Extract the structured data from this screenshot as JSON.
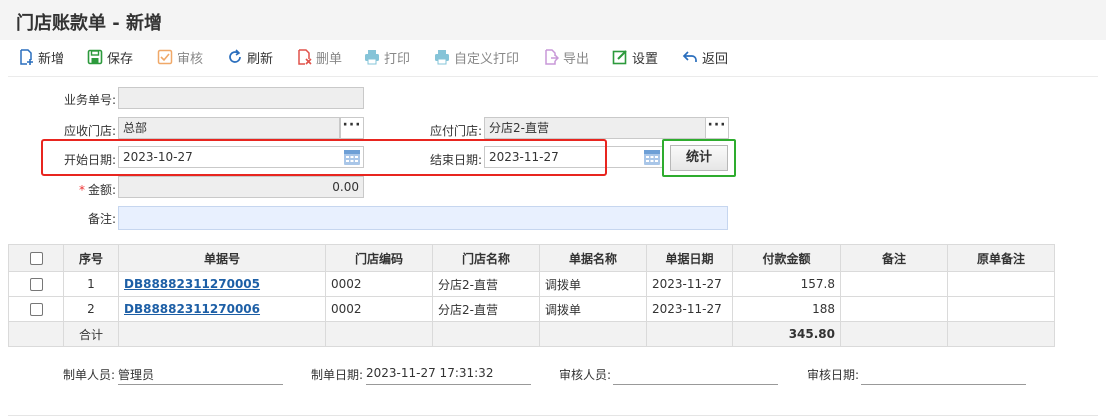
{
  "window": {
    "title": "门店账款单 - 新增"
  },
  "toolbar": {
    "new": "新增",
    "save": "保存",
    "audit": "审核",
    "refresh": "刷新",
    "delete": "删单",
    "print": "打印",
    "custom_print": "自定义打印",
    "export": "导出",
    "settings": "设置",
    "back": "返回"
  },
  "form": {
    "biz_no_label": "业务单号:",
    "biz_no_value": "",
    "recv_store_label": "应收门店:",
    "recv_store_value": "总部",
    "pay_store_label": "应付门店:",
    "pay_store_value": "分店2-直营",
    "start_date_label": "开始日期:",
    "start_date_value": "2023-10-27",
    "end_date_label": "结束日期:",
    "end_date_value": "2023-11-27",
    "stat_button": "统计",
    "amount_required": "*",
    "amount_label": "金额:",
    "amount_value": "0.00",
    "remark_label": "备注:",
    "remark_value": ""
  },
  "table": {
    "headers": [
      "序号",
      "单据号",
      "门店编码",
      "门店名称",
      "单据名称",
      "单据日期",
      "付款金额",
      "备注",
      "原单备注"
    ],
    "rows": [
      {
        "seq": "1",
        "doc_no": "DB88882311270005",
        "store_code": "0002",
        "store_name": "分店2-直营",
        "doc_name": "调拨单",
        "doc_date": "2023-11-27",
        "amount": "157.8",
        "remark": "",
        "orig_remark": ""
      },
      {
        "seq": "2",
        "doc_no": "DB88882311270006",
        "store_code": "0002",
        "store_name": "分店2-直营",
        "doc_name": "调拨单",
        "doc_date": "2023-11-27",
        "amount": "188",
        "remark": "",
        "orig_remark": ""
      }
    ],
    "total_label": "合计",
    "total_amount": "345.80"
  },
  "footer": {
    "maker_label": "制单人员:",
    "maker_value": "管理员",
    "make_date_label": "制单日期:",
    "make_date_value": "2023-11-27 17:31:32",
    "auditor_label": "审核人员:",
    "auditor_value": "",
    "audit_date_label": "审核日期:",
    "audit_date_value": ""
  },
  "colors": {
    "highlight_red": "#e8251f",
    "highlight_green": "#2eac2e",
    "link": "#1d5fa6"
  }
}
